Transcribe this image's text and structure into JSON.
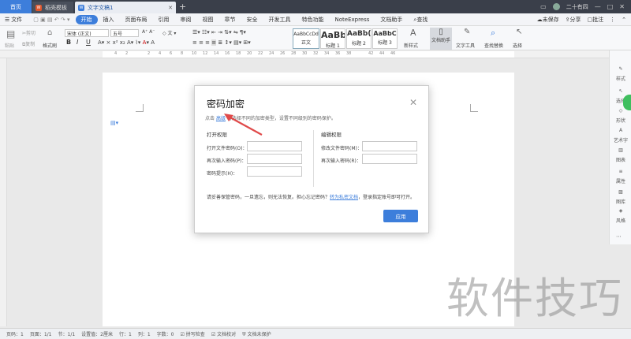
{
  "titlebar": {
    "home_tab": "首页",
    "tabs": [
      {
        "badge": "W",
        "label": "稻壳模板"
      },
      {
        "badge": "W",
        "label": "文字文稿1"
      }
    ],
    "user_name": "二十有四"
  },
  "menubar": {
    "file_label": "文件",
    "items": [
      "开始",
      "插入",
      "页面布局",
      "引用",
      "审阅",
      "视图",
      "章节",
      "安全",
      "开发工具",
      "特色功能",
      "NoteExpress",
      "文档助手"
    ],
    "search_label": "查找",
    "unsaved_label": "未保存",
    "share_label": "分享",
    "comment_label": "批注"
  },
  "ribbon": {
    "paste_label": "粘贴",
    "cut_label": "剪切",
    "copy_label": "复制",
    "format_painter_label": "格式刷",
    "font_name": "宋体 (正文)",
    "font_size": "五号",
    "bold": "B",
    "italic": "I",
    "underline": "U",
    "styles": [
      {
        "sample": "AaBbCcDd",
        "name": "正文"
      },
      {
        "sample": "AaBb",
        "name": "标题 1"
      },
      {
        "sample": "AaBb(",
        "name": "标题 2"
      },
      {
        "sample": "AaBbC",
        "name": "标题 3"
      }
    ],
    "new_style_label": "新样式",
    "doc_helper_label": "文档助手",
    "text_tools_label": "文字工具",
    "find_replace_label": "查找替换",
    "select_label": "选择"
  },
  "ruler_numbers": [
    "4",
    "2",
    "",
    "2",
    "4",
    "6",
    "8",
    "10",
    "12",
    "14",
    "16",
    "18",
    "20",
    "22",
    "24",
    "26",
    "28",
    "30",
    "32",
    "34",
    "36",
    "38",
    "",
    "42",
    "44",
    "46"
  ],
  "sidebar": [
    "样式",
    "选择",
    "形状",
    "艺术字",
    "图表",
    "属性",
    "图库",
    "风格"
  ],
  "dialog": {
    "title": "密码加密",
    "hint_prefix": "点击",
    "hint_link": "高级",
    "hint_suffix": "可选择不同的加密类型，设置不同级别的密码保护。",
    "open_section": "打开权限",
    "open_fields": [
      "打开文件密码(O)：",
      "再次输入密码(P)：",
      "密码提示(H)："
    ],
    "edit_section": "编辑权限",
    "edit_fields": [
      "修改文件密码(M)：",
      "再次输入密码(R)："
    ],
    "warn_prefix": "请妥善保管密码，一旦遗忘，则无法恢复。担心忘记密码？",
    "warn_link": "转为私密文档",
    "warn_suffix": "，登录指定账号即可打开。",
    "apply_label": "应用"
  },
  "watermark": "软件技巧",
  "statusbar": [
    "页码：1",
    "页面：1/1",
    "节：1/1",
    "设置值：2厘米",
    "行：1",
    "列：1",
    "字数：0",
    "拼写检查",
    "文档校对",
    "文档未保护"
  ],
  "colors": {
    "accent": "#3d7edb",
    "titlebar": "#3a3f4a",
    "arrow": "#e04a4a"
  }
}
